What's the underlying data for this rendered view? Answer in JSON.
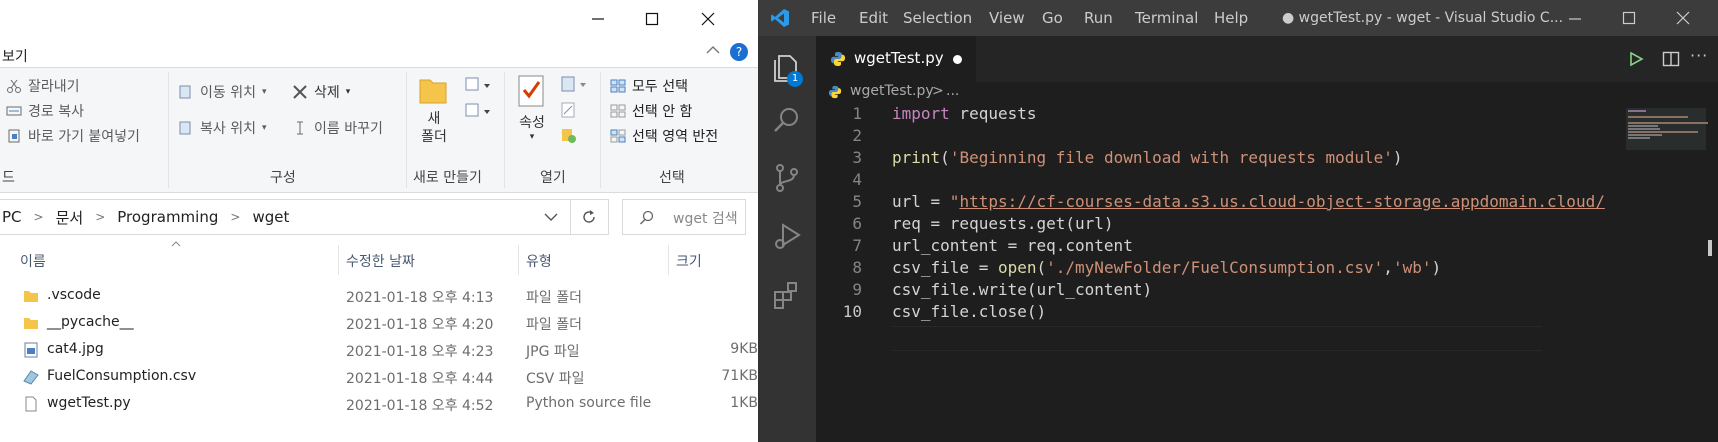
{
  "explorer": {
    "ribbon_tab": "보기",
    "groups": {
      "clipboard": {
        "cut": "잘라내기",
        "copy_path": "경로 복사",
        "paste_shortcut": "바로 가기 붙여넣기",
        "label_fragment": "드"
      },
      "organize": {
        "move_to": "이동 위치",
        "copy_to": "복사 위치",
        "delete": "삭제",
        "rename": "이름 바꾸기",
        "label": "구성"
      },
      "new": {
        "new_folder_line1": "새",
        "new_folder_line2": "폴더",
        "label": "새로 만들기"
      },
      "open": {
        "properties": "속성",
        "label": "열기"
      },
      "select": {
        "select_all": "모두 선택",
        "select_none": "선택 안 함",
        "invert": "선택 영역 반전",
        "label": "선택"
      }
    },
    "breadcrumb": [
      "PC",
      "문서",
      "Programming",
      "wget"
    ],
    "search_placeholder": "wget 검색",
    "columns": {
      "name": "이름",
      "date": "수정한 날짜",
      "type": "유형",
      "size": "크기"
    },
    "files": [
      {
        "name": ".vscode",
        "date": "2021-01-18 오후 4:13",
        "type": "파일 폴더",
        "size": "",
        "kind": "folder"
      },
      {
        "name": "__pycache__",
        "date": "2021-01-18 오후 4:20",
        "type": "파일 폴더",
        "size": "",
        "kind": "folder"
      },
      {
        "name": "cat4.jpg",
        "date": "2021-01-18 오후 4:23",
        "type": "JPG 파일",
        "size": "9KB",
        "kind": "image"
      },
      {
        "name": "FuelConsumption.csv",
        "date": "2021-01-18 오후 4:44",
        "type": "CSV 파일",
        "size": "71KB",
        "kind": "csv"
      },
      {
        "name": "wgetTest.py",
        "date": "2021-01-18 오후 4:52",
        "type": "Python source file",
        "size": "1KB",
        "kind": "file"
      }
    ]
  },
  "vscode": {
    "menu": [
      "File",
      "Edit",
      "Selection",
      "View",
      "Go",
      "Run",
      "Terminal",
      "Help"
    ],
    "title": "● wgetTest.py - wget - Visual Studio C...",
    "tab_label": "wgetTest.py",
    "breadcrumb_file": "wgetTest.py",
    "breadcrumb_more": "...",
    "notification_badge": "1",
    "line_numbers": [
      "1",
      "2",
      "3",
      "4",
      "5",
      "6",
      "7",
      "8",
      "9",
      "10"
    ],
    "code": {
      "l1_kw": "import",
      "l1_rest": " requests",
      "l3_fn": "print",
      "l3_p1": "(",
      "l3_str": "'Beginning file download with requests module'",
      "l3_p2": ")",
      "l5_pre": "url = ",
      "l5_q": "\"",
      "l5_url": "https://cf-courses-data.s3.us.cloud-object-storage.appdomain.cloud/",
      "l6": "req = requests.get(url)",
      "l7": "url_content = req.content",
      "l8_pre": "csv_file = ",
      "l8_fn": "open",
      "l8_p1": "(",
      "l8_s1": "'./myNewFolder/FuelConsumption.csv'",
      "l8_c": ",",
      "l8_s2": "'wb'",
      "l8_p2": ")",
      "l9": "csv_file.write(url_content)",
      "l10": "csv_file.close()"
    }
  },
  "colors": {
    "vscode_bg": "#1e1e1e",
    "vscode_titlebar": "#3c3c3c",
    "vscode_activity": "#333333",
    "vscode_accent": "#0078d4",
    "run_green": "#89d185",
    "keyword": "#c586c0",
    "function": "#dcdcaa",
    "string": "#ce9178"
  },
  "icons": [
    "scissors-icon",
    "copy-path-icon",
    "paste-shortcut-icon",
    "move-icon",
    "copy-icon",
    "delete-icon",
    "rename-icon",
    "folder-icon",
    "new-item-icon",
    "properties-icon",
    "open-icon",
    "edit-icon",
    "history-icon",
    "select-all-icon",
    "select-none-icon",
    "invert-selection-icon",
    "chevron-down-icon",
    "refresh-icon",
    "search-icon",
    "help-icon",
    "vscode-logo-icon",
    "files-icon",
    "search-icon",
    "source-control-icon",
    "run-debug-icon",
    "extensions-icon",
    "python-icon",
    "run-icon",
    "split-editor-icon",
    "more-icon"
  ]
}
